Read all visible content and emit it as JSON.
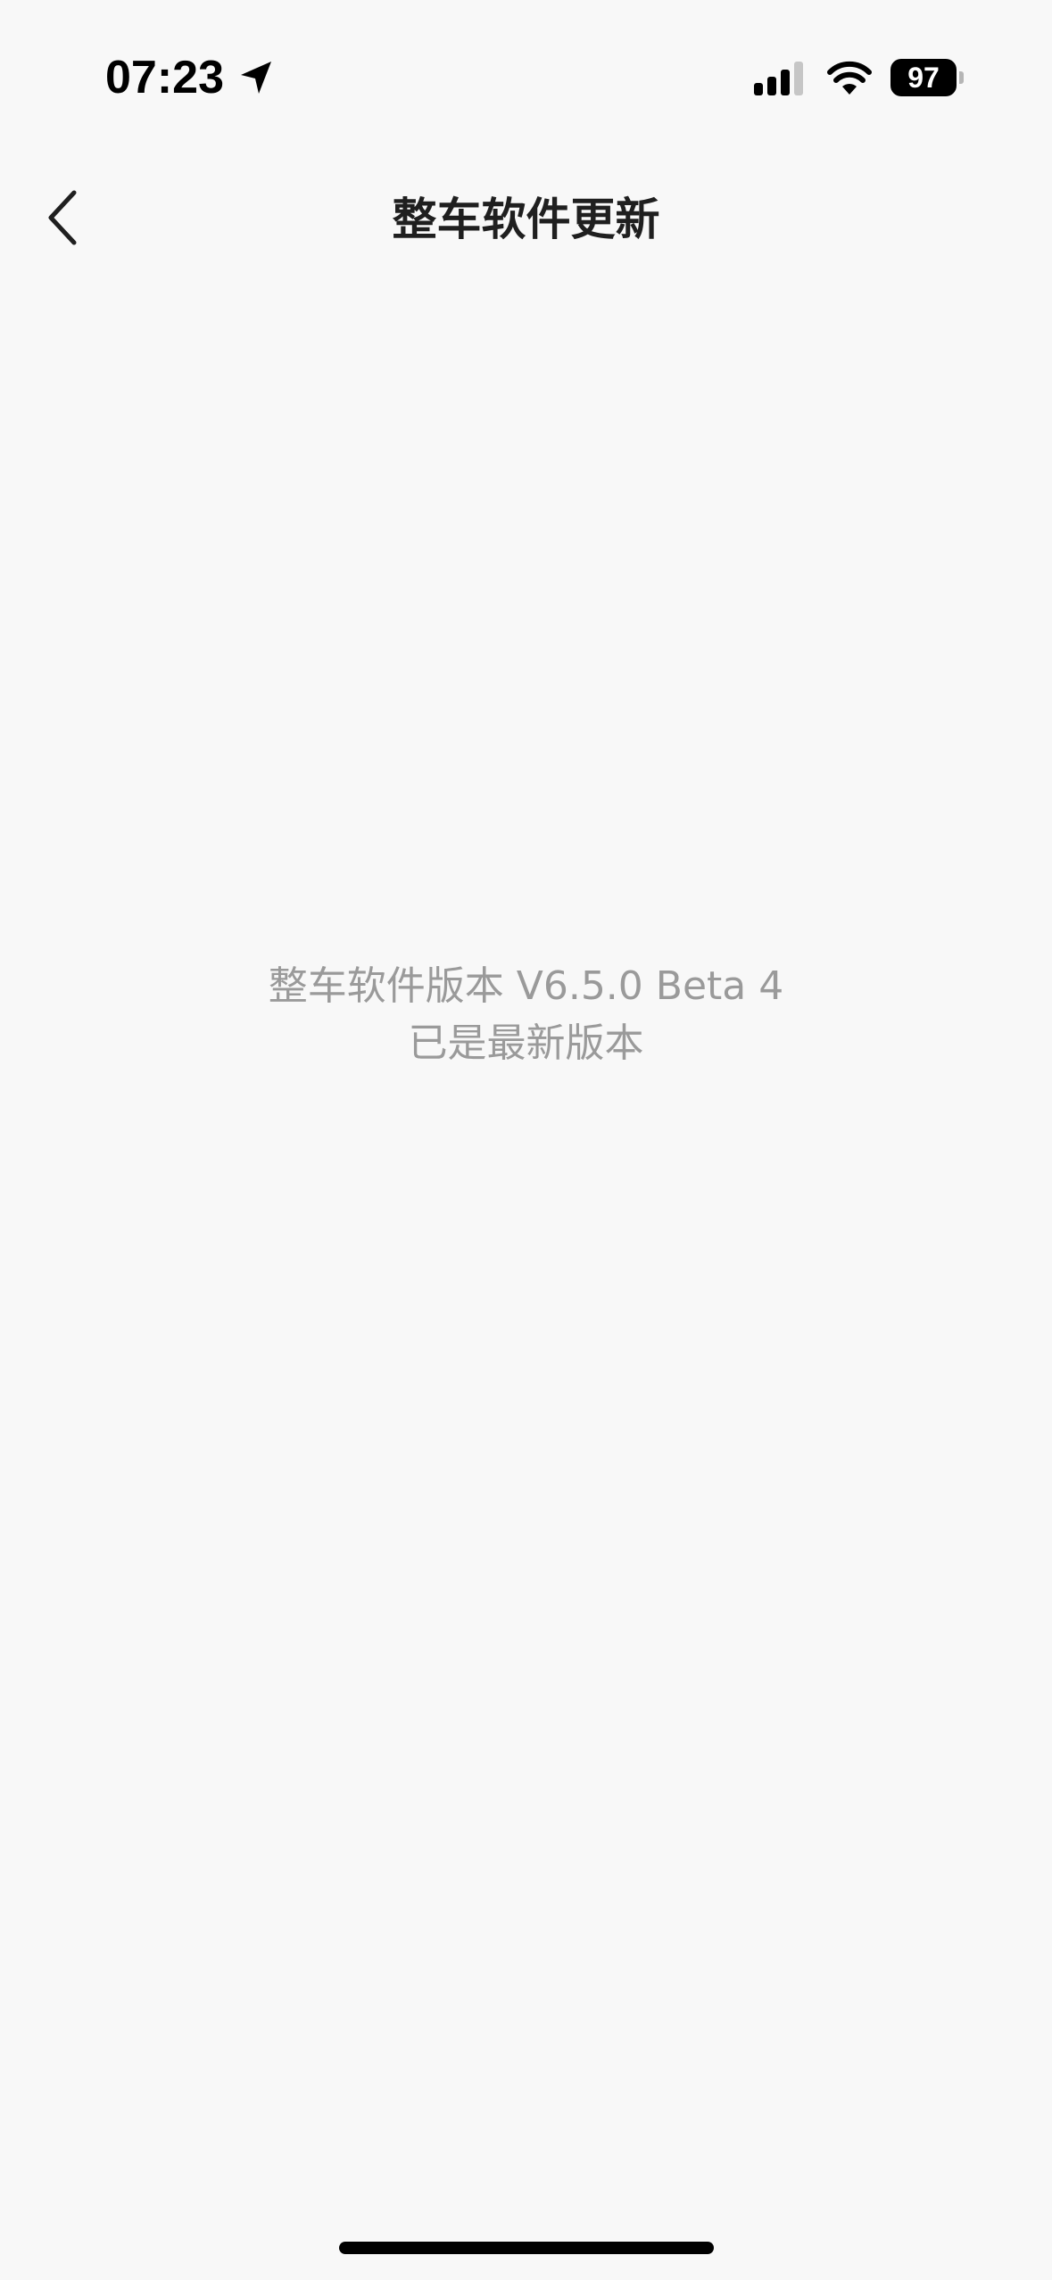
{
  "status_bar": {
    "time": "07:23",
    "battery_level": "97",
    "icons": [
      "location-arrow-icon",
      "cellular-signal-icon",
      "wifi-icon",
      "battery-icon"
    ]
  },
  "nav": {
    "title": "整车软件更新",
    "back_icon": "chevron-left-icon"
  },
  "message": {
    "version_line": "整车软件版本 V6.5.0 Beta 4",
    "status_line": "已是最新版本"
  },
  "colors": {
    "background": "#f8f8f8",
    "title": "#1f1f1f",
    "message": "#9a9a9a"
  }
}
